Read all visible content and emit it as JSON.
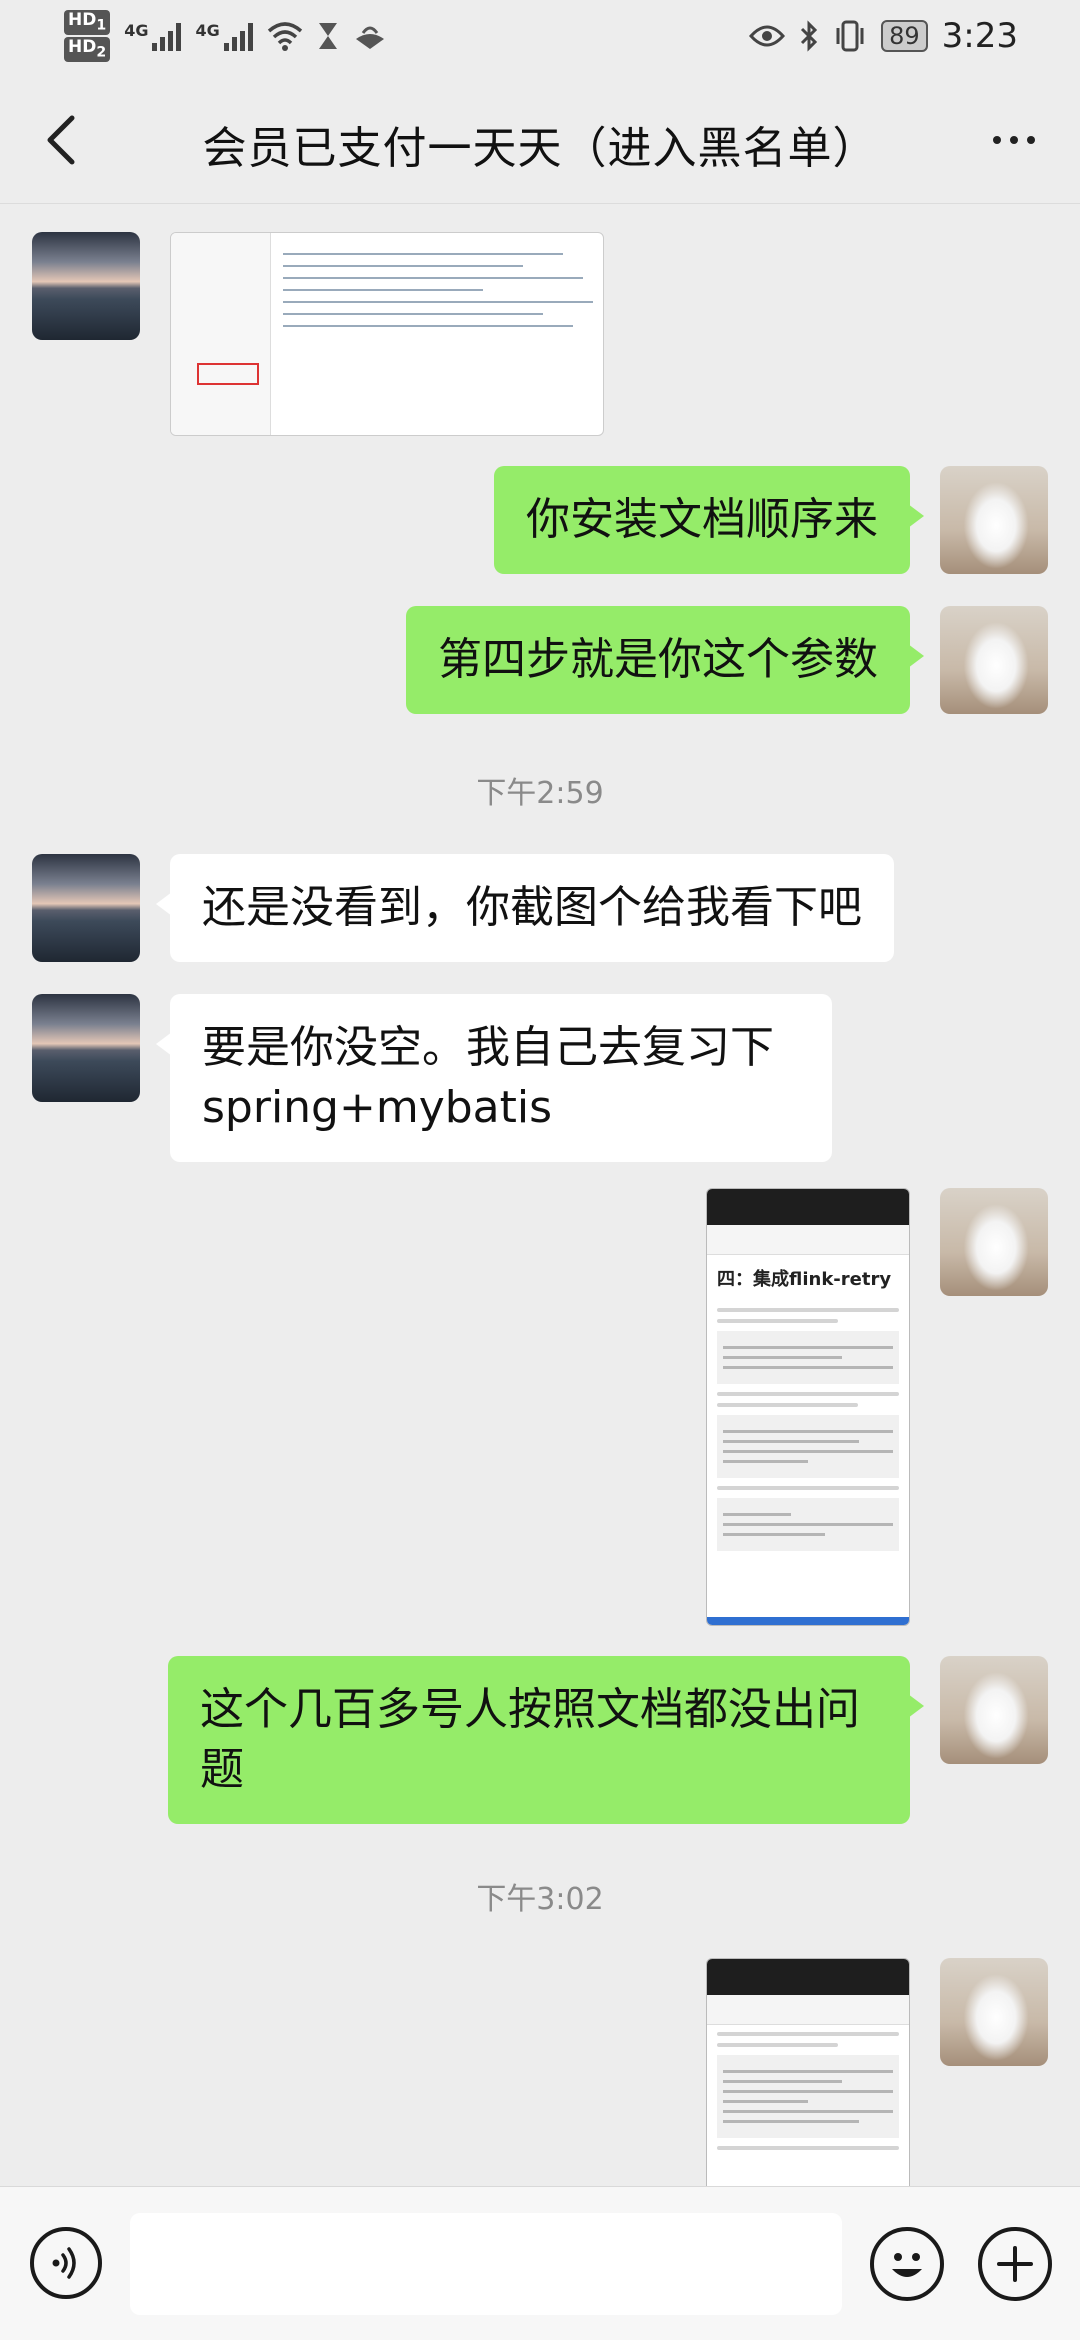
{
  "status_bar": {
    "hd1": "HD",
    "hd1_sub": "1",
    "hd2": "HD",
    "hd2_sub": "2",
    "net1": "4G",
    "net2": "4G",
    "battery": "89",
    "time": "3:23"
  },
  "header": {
    "title": "会员已支付一天天（进入黑名单）"
  },
  "messages": [
    {
      "id": "m1",
      "side": "left",
      "type": "image",
      "icon": "ide-screenshot"
    },
    {
      "id": "m2",
      "side": "right",
      "type": "text",
      "text": "你安装文档顺序来"
    },
    {
      "id": "m3",
      "side": "right",
      "type": "text",
      "text": "第四步就是你这个参数"
    },
    {
      "id": "t1",
      "type": "time",
      "text": "下午2:59"
    },
    {
      "id": "m4",
      "side": "left",
      "type": "text",
      "text": "还是没看到，你截图个给我看下吧"
    },
    {
      "id": "m5",
      "side": "left",
      "type": "text",
      "text": "要是你没空。我自己去复习下\nspring+mybatis"
    },
    {
      "id": "m6",
      "side": "right",
      "type": "image",
      "icon": "phone-screenshot",
      "caption": "四：集成flink-retry"
    },
    {
      "id": "m7",
      "side": "right",
      "type": "text",
      "text": "这个几百多号人按照文档都没出问\n题"
    },
    {
      "id": "t2",
      "type": "time",
      "text": "下午3:02"
    },
    {
      "id": "m8",
      "side": "right",
      "type": "image",
      "icon": "phone-screenshot"
    }
  ],
  "input_bar": {
    "placeholder": "",
    "value": ""
  },
  "colors": {
    "my_bubble": "#95ec69",
    "other_bubble": "#ffffff",
    "background": "#ededed"
  }
}
